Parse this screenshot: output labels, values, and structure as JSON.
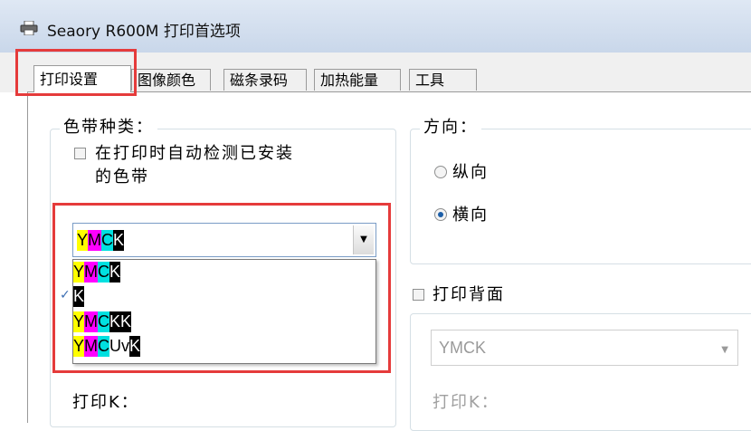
{
  "window": {
    "title": "Seaory R600M 打印首选项"
  },
  "tabs": [
    {
      "label": "打印设置",
      "active": true
    },
    {
      "label": "图像颜色",
      "active": false
    },
    {
      "label": "磁条录码",
      "active": false
    },
    {
      "label": "加热能量",
      "active": false
    },
    {
      "label": "工具",
      "active": false
    }
  ],
  "ribbon_group": {
    "legend": "色带种类：",
    "auto_detect_line1": "在打印时自动检测已安装",
    "auto_detect_line2": "的色带",
    "auto_detect_checked": false
  },
  "ribbon_combo": {
    "selected": [
      {
        "t": "Y",
        "c": "Y"
      },
      {
        "t": "M",
        "c": "M"
      },
      {
        "t": "C",
        "c": "C"
      },
      {
        "t": "K",
        "c": "K"
      }
    ],
    "options": [
      [
        {
          "t": "Y",
          "c": "Y"
        },
        {
          "t": "M",
          "c": "M"
        },
        {
          "t": "C",
          "c": "C"
        },
        {
          "t": "K",
          "c": "K"
        }
      ],
      [
        {
          "t": "K",
          "c": "K"
        }
      ],
      [
        {
          "t": "Y",
          "c": "Y"
        },
        {
          "t": "M",
          "c": "M"
        },
        {
          "t": "C",
          "c": "C"
        },
        {
          "t": "K",
          "c": "K"
        },
        {
          "t": "K",
          "c": "K"
        }
      ],
      [
        {
          "t": "Y",
          "c": "Y"
        },
        {
          "t": "M",
          "c": "M"
        },
        {
          "t": "C",
          "c": "C"
        },
        {
          "t": "Uv",
          "c": "O"
        },
        {
          "t": "K",
          "c": "K"
        }
      ]
    ]
  },
  "orientation": {
    "legend": "方向：",
    "portrait": "纵向",
    "landscape": "横向",
    "selected": "landscape"
  },
  "print_back": {
    "label": "打印背面",
    "checked": false
  },
  "back_combo": {
    "value": "YMCK"
  },
  "print_k_label": "打印K：",
  "print_k_label_back": "打印K："
}
